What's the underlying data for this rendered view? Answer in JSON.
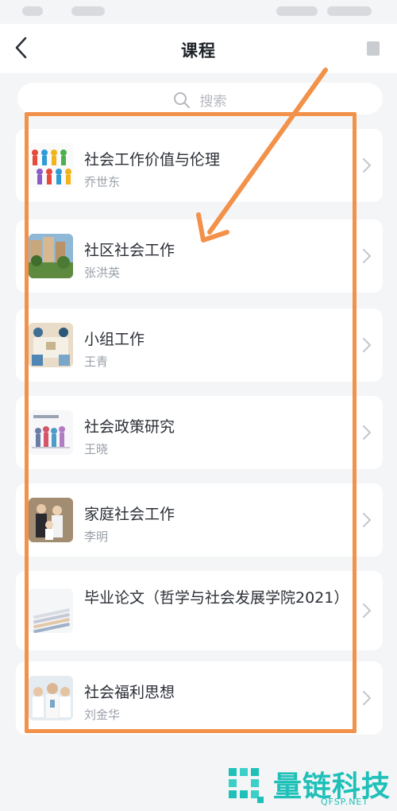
{
  "header": {
    "title": "课程"
  },
  "search": {
    "placeholder": "搜索"
  },
  "courses": [
    {
      "title": "社会工作价值与伦理",
      "teacher": "乔世东"
    },
    {
      "title": "社区社会工作",
      "teacher": "张洪英"
    },
    {
      "title": "小组工作",
      "teacher": "王青"
    },
    {
      "title": "社会政策研究",
      "teacher": "王晓"
    },
    {
      "title": "家庭社会工作",
      "teacher": "李明"
    },
    {
      "title": "毕业论文（哲学与社会发展学院2021）",
      "teacher": ""
    },
    {
      "title": "社会福利思想",
      "teacher": "刘金华"
    }
  ],
  "watermark": {
    "brand": "量链科技",
    "domain": "QFSP.NET"
  },
  "colors": {
    "annotation": "#f2924a",
    "watermark": "#1ec0b8",
    "background": "#f4f5f7"
  }
}
